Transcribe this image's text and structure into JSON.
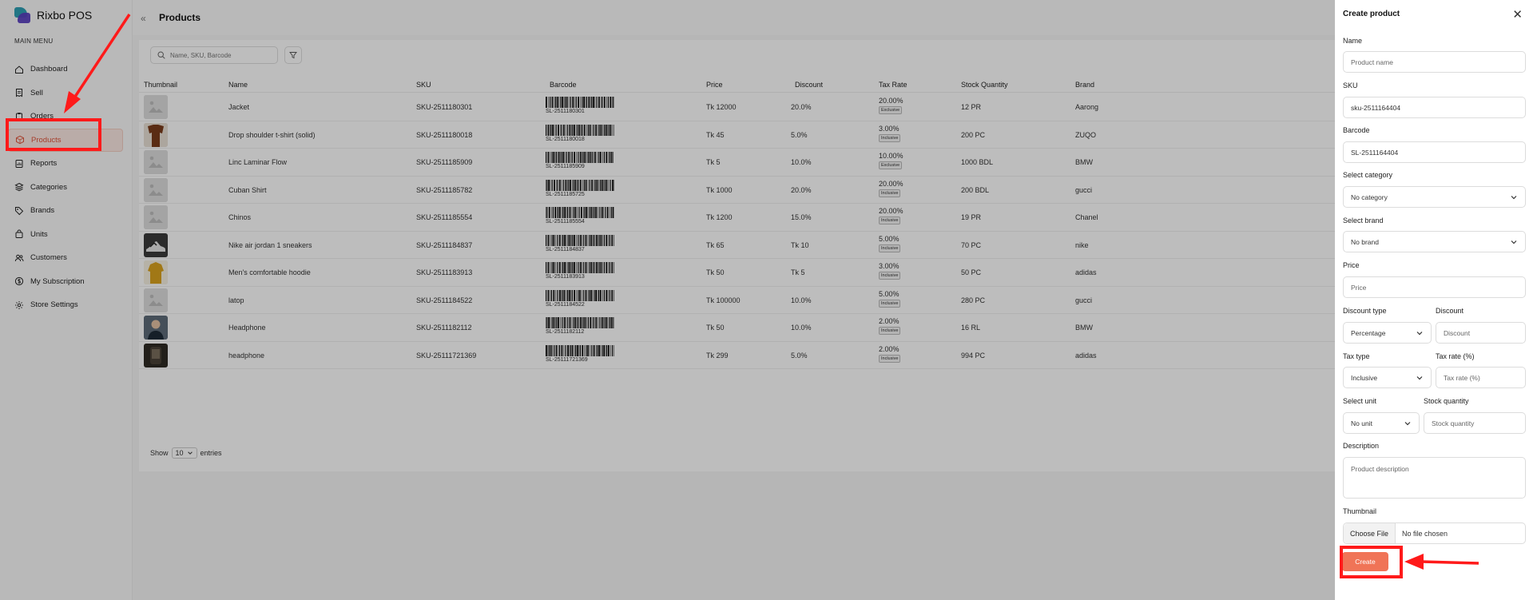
{
  "app": {
    "name": "Rixbo POS",
    "menu_heading": "MAIN MENU"
  },
  "sidebar": {
    "items": [
      {
        "label": "Dashboard",
        "icon": "home-icon"
      },
      {
        "label": "Sell",
        "icon": "receipt-icon"
      },
      {
        "label": "Orders",
        "icon": "clipboard-icon"
      },
      {
        "label": "Products",
        "icon": "box-icon"
      },
      {
        "label": "Reports",
        "icon": "report-icon"
      },
      {
        "label": "Categories",
        "icon": "layers-icon"
      },
      {
        "label": "Brands",
        "icon": "tag-icon"
      },
      {
        "label": "Units",
        "icon": "bag-icon"
      },
      {
        "label": "Customers",
        "icon": "users-icon"
      },
      {
        "label": "My Subscription",
        "icon": "dollar-icon"
      },
      {
        "label": "Store Settings",
        "icon": "gear-icon"
      }
    ],
    "active": "Products"
  },
  "header": {
    "title": "Products",
    "collapse_glyph": "«"
  },
  "search": {
    "placeholder": "Name, SKU, Barcode"
  },
  "table": {
    "columns": [
      "Thumbnail",
      "Name",
      "SKU",
      "Barcode",
      "Price",
      "Discount",
      "Tax Rate",
      "Stock Quantity",
      "Brand"
    ],
    "rows": [
      {
        "name": "Jacket",
        "sku": "SKU-2511180301",
        "barcode": "SL-2511180301",
        "price": "Tk 12000",
        "discount": "20.0%",
        "tax": "20.00%",
        "tax_type": "Exclusive",
        "stock": "12 PR",
        "brand": "Aarong",
        "thumb": "placeholder"
      },
      {
        "name": "Drop shoulder t-shirt (solid)",
        "sku": "SKU-2511180018",
        "barcode": "SL-2511180018",
        "price": "Tk 45",
        "discount": "5.0%",
        "tax": "3.00%",
        "tax_type": "Inclusive",
        "stock": "200 PC",
        "brand": "ZUQO",
        "thumb": "brown-shirt"
      },
      {
        "name": "Linc Laminar Flow",
        "sku": "SKU-2511185909",
        "barcode": "SL-2511185909",
        "price": "Tk 5",
        "discount": "10.0%",
        "tax": "10.00%",
        "tax_type": "Exclusive",
        "stock": "1000 BDL",
        "brand": "BMW",
        "thumb": "placeholder"
      },
      {
        "name": "Cuban Shirt",
        "sku": "SKU-2511185782",
        "barcode": "SL-2511185725",
        "price": "Tk 1000",
        "discount": "20.0%",
        "tax": "20.00%",
        "tax_type": "Inclusive",
        "stock": "200 BDL",
        "brand": "gucci",
        "thumb": "placeholder"
      },
      {
        "name": "Chinos",
        "sku": "SKU-2511185554",
        "barcode": "SL-2511185554",
        "price": "Tk 1200",
        "discount": "15.0%",
        "tax": "20.00%",
        "tax_type": "Inclusive",
        "stock": "19 PR",
        "brand": "Chanel",
        "thumb": "placeholder"
      },
      {
        "name": "Nike air jordan 1 sneakers",
        "sku": "SKU-2511184837",
        "barcode": "SL-2511184837",
        "price": "Tk 65",
        "discount": "Tk 10",
        "tax": "5.00%",
        "tax_type": "Inclusive",
        "stock": "70 PC",
        "brand": "nike",
        "thumb": "sneaker"
      },
      {
        "name": "Men's comfortable hoodie",
        "sku": "SKU-2511183913",
        "barcode": "SL-2511183913",
        "price": "Tk 50",
        "discount": "Tk 5",
        "tax": "3.00%",
        "tax_type": "Inclusive",
        "stock": "50 PC",
        "brand": "adidas",
        "thumb": "yellow-hoodie"
      },
      {
        "name": "latop",
        "sku": "SKU-2511184522",
        "barcode": "SL-2511184522",
        "price": "Tk 100000",
        "discount": "10.0%",
        "tax": "5.00%",
        "tax_type": "Inclusive",
        "stock": "280 PC",
        "brand": "gucci",
        "thumb": "placeholder"
      },
      {
        "name": "Headphone",
        "sku": "SKU-2511182112",
        "barcode": "SL-2511182112",
        "price": "Tk 50",
        "discount": "10.0%",
        "tax": "2.00%",
        "tax_type": "Inclusive",
        "stock": "16 RL",
        "brand": "BMW",
        "thumb": "person"
      },
      {
        "name": "headphone",
        "sku": "SKU-25111721369",
        "barcode": "SL-25111721369",
        "price": "Tk 299",
        "discount": "5.0%",
        "tax": "2.00%",
        "tax_type": "Inclusive",
        "stock": "994 PC",
        "brand": "adidas",
        "thumb": "dark-device"
      }
    ]
  },
  "pager": {
    "show": "Show",
    "size": "10",
    "entries": "entries"
  },
  "drawer": {
    "title": "Create product",
    "name_label": "Name",
    "name_placeholder": "Product name",
    "sku_label": "SKU",
    "sku_value": "sku-2511164404",
    "barcode_label": "Barcode",
    "barcode_value": "SL-2511164404",
    "category_label": "Select category",
    "category_value": "No category",
    "brand_label": "Select brand",
    "brand_value": "No brand",
    "price_label": "Price",
    "price_placeholder": "Price",
    "discount_type_label": "Discount type",
    "discount_type_value": "Percentage",
    "discount_label": "Discount",
    "discount_placeholder": "Discount",
    "tax_type_label": "Tax type",
    "tax_type_value": "Inclusive",
    "tax_rate_label": "Tax rate (%)",
    "tax_rate_placeholder": "Tax rate (%)",
    "unit_label": "Select unit",
    "unit_value": "No unit",
    "stock_label": "Stock quantity",
    "stock_placeholder": "Stock quantity",
    "description_label": "Description",
    "description_placeholder": "Product description",
    "thumbnail_label": "Thumbnail",
    "choose_file": "Choose File",
    "no_file": "No file chosen",
    "create_label": "Create"
  },
  "colors": {
    "accent": "#f07457",
    "annotation": "#ff1a1a",
    "active_text": "#e1543c"
  }
}
